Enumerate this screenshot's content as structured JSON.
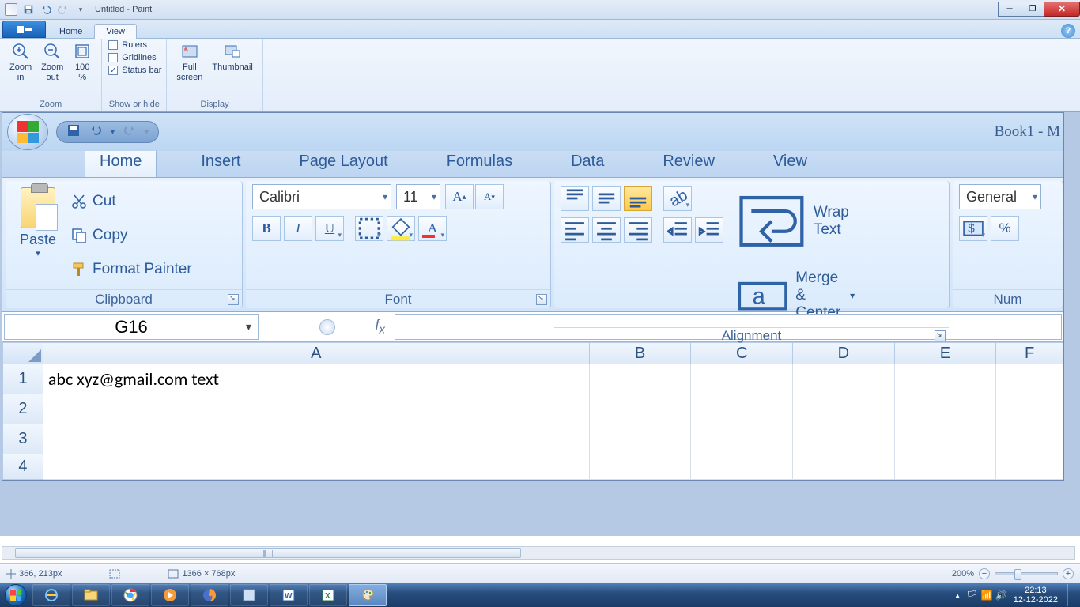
{
  "paint": {
    "title": "Untitled - Paint",
    "tabs": {
      "home": "Home",
      "view": "View"
    },
    "zoom": {
      "in": "Zoom\nin",
      "out": "Zoom\nout",
      "full": "100\n%",
      "group_label": "Zoom"
    },
    "show": {
      "rulers": "Rulers",
      "gridlines": "Gridlines",
      "statusbar": "Status bar",
      "group_label": "Show or hide"
    },
    "display": {
      "fullscreen": "Full\nscreen",
      "thumbnail": "Thumbnail",
      "group_label": "Display"
    },
    "status": {
      "pos": "366, 213px",
      "dim": "1366 × 768px",
      "zoom": "200%"
    }
  },
  "excel": {
    "doc_title": "Book1 - M",
    "tabs": {
      "home": "Home",
      "insert": "Insert",
      "pagelayout": "Page Layout",
      "formulas": "Formulas",
      "data": "Data",
      "review": "Review",
      "view": "View"
    },
    "clipboard": {
      "paste": "Paste",
      "cut": "Cut",
      "copy": "Copy",
      "format_painter": "Format Painter",
      "label": "Clipboard"
    },
    "font": {
      "name": "Calibri",
      "size": "11",
      "label": "Font"
    },
    "alignment": {
      "wrap": "Wrap Text",
      "merge": "Merge & Center",
      "label": "Alignment"
    },
    "number": {
      "format": "General",
      "label": "Num"
    },
    "name_box": "G16",
    "columns": [
      "A",
      "B",
      "C",
      "D",
      "E",
      "F"
    ],
    "row_headers": [
      "1",
      "2",
      "3",
      "4"
    ],
    "cell_A1": "abc  xyz@gmail.com text"
  },
  "taskbar": {
    "time": "22:13",
    "date": "12-12-2022"
  }
}
